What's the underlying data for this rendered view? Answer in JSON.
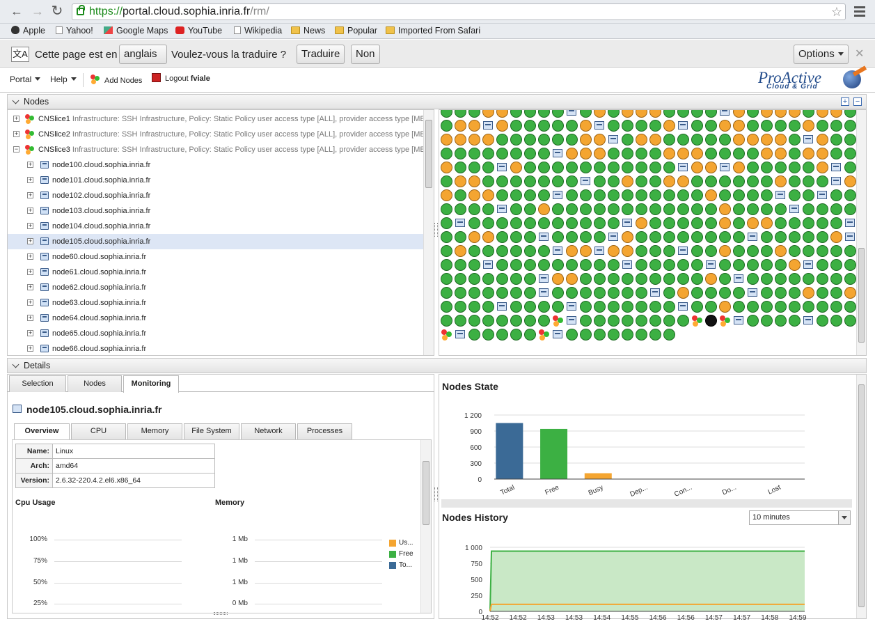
{
  "browser": {
    "url_scheme": "https://",
    "url_host": "portal.cloud.sophia.inria.fr",
    "url_path": "/rm/",
    "bookmarks": [
      "Apple",
      "Yahoo!",
      "Google Maps",
      "YouTube",
      "Wikipedia",
      "News",
      "Popular",
      "Imported From Safari"
    ]
  },
  "translate_bar": {
    "prefix": "Cette page est en",
    "language": "anglais",
    "question": "Voulez-vous la traduire ?",
    "translate_label": "Traduire",
    "no_label": "Non",
    "options_label": "Options"
  },
  "toolbar": {
    "portal": "Portal",
    "help": "Help",
    "add_nodes": "Add Nodes",
    "logout": "Logout",
    "user": "fviale",
    "logo_main": "ProActive",
    "logo_sub": "Cloud & Grid"
  },
  "nodes_panel": {
    "title": "Nodes",
    "slices": [
      {
        "name": "CNSlice1",
        "desc": "Infrastructure: SSH Infrastructure, Policy: Static Policy user access type [ALL], provider access type [ME"
      },
      {
        "name": "CNSlice2",
        "desc": "Infrastructure: SSH Infrastructure, Policy: Static Policy user access type [ALL], provider access type [ME"
      },
      {
        "name": "CNSlice3",
        "desc": "Infrastructure: SSH Infrastructure, Policy: Static Policy user access type [ALL], provider access type [ME"
      }
    ],
    "nodes": [
      "node100.cloud.sophia.inria.fr",
      "node101.cloud.sophia.inria.fr",
      "node102.cloud.sophia.inria.fr",
      "node103.cloud.sophia.inria.fr",
      "node104.cloud.sophia.inria.fr",
      "node105.cloud.sophia.inria.fr",
      "node60.cloud.sophia.inria.fr",
      "node61.cloud.sophia.inria.fr",
      "node62.cloud.sophia.inria.fr",
      "node63.cloud.sophia.inria.fr",
      "node64.cloud.sophia.inria.fr",
      "node65.cloud.sophia.inria.fr",
      "node66.cloud.sophia.inria.fr"
    ],
    "selected_node_index": 5
  },
  "node_grid_rows": [
    "FFFBBFFFFNFBFBBBFFFFNBFBBBFBBFF",
    "FBBNBFFFFFBNFFFFBNFFBBFFFFBFFFF",
    "BBBBFFFFFFBBNFBBFFFFFBBBBFNBFFB",
    "FFFFFFFFNBBBFFFFBBBFFFFBBFBBFFF",
    "BFFFNBFFFFFFFFFFFNBBNBFFFFFBNFF",
    "FBBFFFFFFFNFFBFFBBFFFFFFBFFFNBB",
    "BFBBFFFFNFFFFFFFFFFBFFFFNFFNFFB",
    "FFFFNFFBFFFFFFFFFFFFBFFFFNFFFFB",
    "FNFFFFFFFFFFFNBFFFFFBFBBFFFFFNF",
    "FFBBFFFNFFFFNBFFFFFFFFNFFFFFBNF",
    "FBFFFFFFNBBNBBFFFNFFBFFFBFFFFFN",
    "FFFNFFFFFFFFFNFFFFFNFFFFFBNFFFF",
    "FFFFFFFNBBFFFFFFFFFBFNFFFFFFFFF",
    "FFFFFFFNFFFFFFFNFBFFFFNFFFBFFBF",
    "FFFFNFFFFNFFFFFFFNFFBFFFFFFFFFF",
    "FFFFFFFFSNFFFFFFFFSDSNFFFFNFFFF",
    "SNFFFFFSNFFFFFFFF"
  ],
  "details": {
    "title": "Details",
    "tabs": [
      "Selection",
      "Nodes",
      "Monitoring"
    ],
    "active_tab": "Monitoring",
    "node_title": "node105.cloud.sophia.inria.fr",
    "subtabs": [
      "Overview",
      "CPU",
      "Memory",
      "File System",
      "Network",
      "Processes"
    ],
    "info": [
      {
        "key": "Name:",
        "value": "Linux"
      },
      {
        "key": "Arch:",
        "value": "amd64"
      },
      {
        "key": "Version:",
        "value": "2.6.32-220.4.2.el6.x86_64"
      }
    ],
    "cpu_usage": {
      "title": "Cpu Usage",
      "ticks": [
        "100%",
        "75%",
        "50%",
        "25%"
      ]
    },
    "memory": {
      "title": "Memory",
      "ticks": [
        "1 Mb",
        "1 Mb",
        "1 Mb",
        "0 Mb"
      ],
      "legend": [
        "Us...",
        "Free",
        "To..."
      ]
    }
  },
  "colors": {
    "free": "#3cb043",
    "busy": "#f4a531",
    "total": "#3b6a96",
    "used_legend": "#f4a531",
    "free_legend": "#3cb043",
    "total_legend": "#3b6a96"
  },
  "chart_data": [
    {
      "type": "bar",
      "title": "Nodes State",
      "categories": [
        "Total",
        "Free",
        "Busy",
        "Dep...",
        "Con...",
        "Do...",
        "Lost"
      ],
      "values": [
        1050,
        940,
        110,
        0,
        0,
        0,
        0
      ],
      "yticks": [
        "1 200",
        "900",
        "600",
        "300",
        "0"
      ],
      "ylim": [
        0,
        1200
      ],
      "colors": [
        "#3b6a96",
        "#3cb043",
        "#f4a531",
        "#999999",
        "#999999",
        "#999999",
        "#999999"
      ]
    },
    {
      "type": "area",
      "title": "Nodes History",
      "range_option": "10 minutes",
      "yticks": [
        "1 000",
        "750",
        "500",
        "250",
        "0"
      ],
      "ylim": [
        0,
        1000
      ],
      "x": [
        "14:52",
        "14:52",
        "14:53",
        "14:53",
        "14:54",
        "14:55",
        "14:56",
        "14:56",
        "14:57",
        "14:57",
        "14:58",
        "14:59"
      ],
      "series": [
        {
          "name": "Free",
          "values": [
            0,
            940,
            940,
            940,
            940,
            940,
            940,
            940,
            940,
            940,
            940,
            940
          ]
        },
        {
          "name": "Busy",
          "values": [
            0,
            110,
            110,
            110,
            110,
            110,
            110,
            110,
            110,
            110,
            110,
            110
          ]
        }
      ]
    }
  ]
}
